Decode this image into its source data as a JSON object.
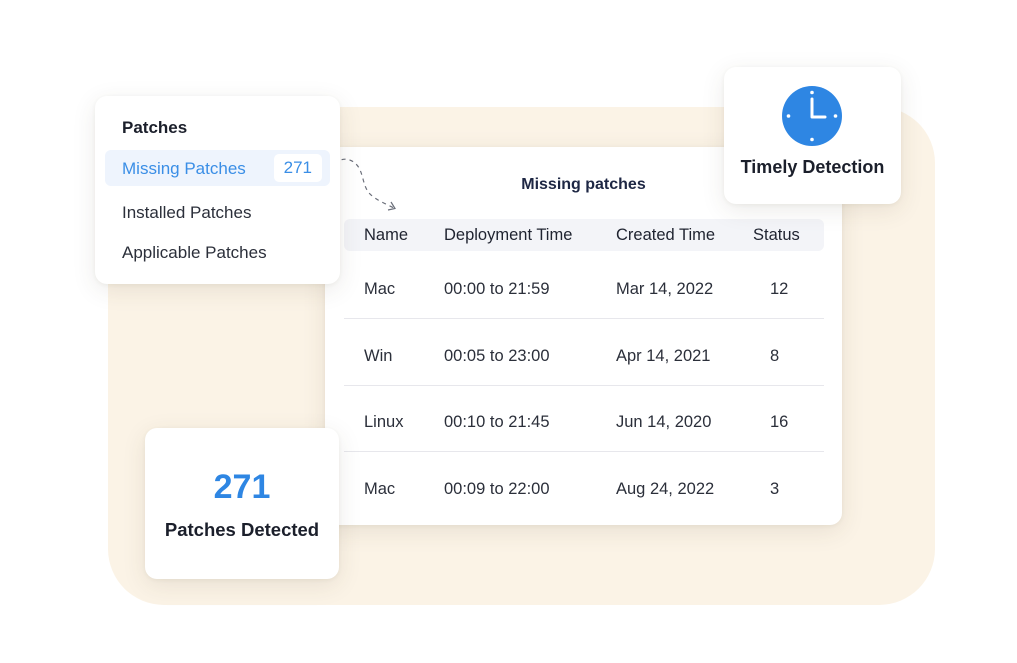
{
  "patches_menu": {
    "heading": "Patches",
    "items": [
      {
        "label": "Missing Patches",
        "badge": "271",
        "active": true
      },
      {
        "label": "Installed Patches"
      },
      {
        "label": "Applicable Patches"
      }
    ]
  },
  "missing_table": {
    "title": "Missing patches",
    "columns": [
      "Name",
      "Deployment Time",
      "Created Time",
      "Status"
    ],
    "rows": [
      {
        "name": "Mac",
        "deployment_time": "00:00 to 21:59",
        "created_time": "Mar 14, 2022",
        "status": "12"
      },
      {
        "name": "Win",
        "deployment_time": "00:05 to 23:00",
        "created_time": "Apr 14, 2021",
        "status": "8"
      },
      {
        "name": "Linux",
        "deployment_time": "00:10 to 21:45",
        "created_time": "Jun 14, 2020",
        "status": "16"
      },
      {
        "name": "Mac",
        "deployment_time": "00:09 to 22:00",
        "created_time": "Aug 24, 2022",
        "status": "3"
      }
    ]
  },
  "timely_card": {
    "icon": "clock-icon",
    "label": "Timely Detection"
  },
  "detected_card": {
    "count": "271",
    "label": "Patches Detected"
  },
  "colors": {
    "accent": "#2e86e3",
    "active_bg": "#eef4fd",
    "backdrop": "#fbf3e6"
  }
}
